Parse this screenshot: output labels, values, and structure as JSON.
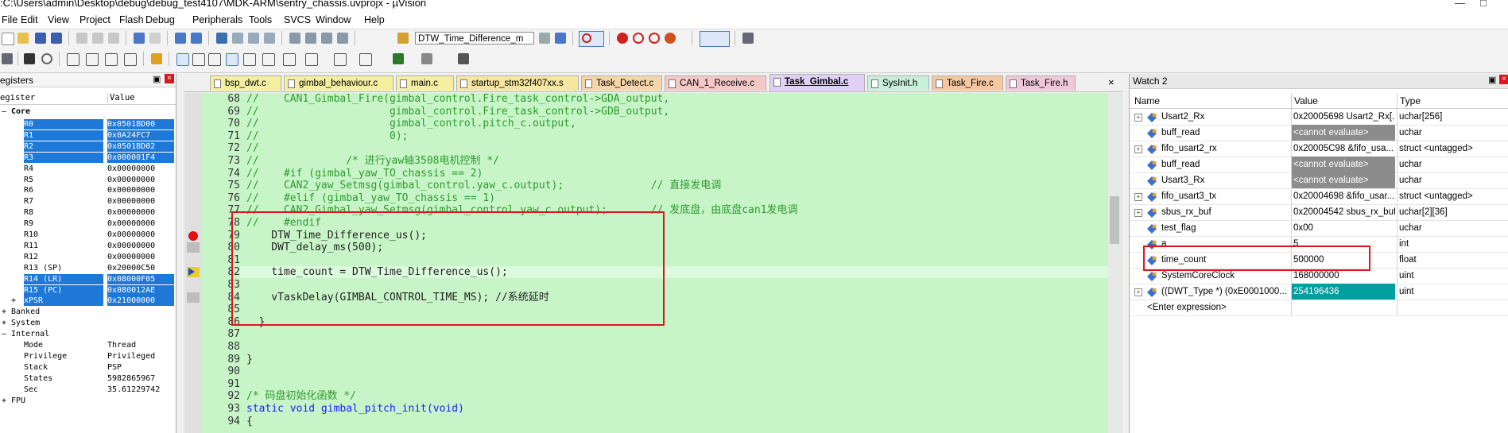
{
  "window": {
    "title": ":C:\\Users\\admin\\Desktop\\debug\\debug_test4107\\MDK-ARM\\sentry_chassis.uvprojx - µVision"
  },
  "menu": [
    "File",
    "Edit",
    "View",
    "Project",
    "Flash",
    "Debug",
    "Peripherals",
    "Tools",
    "SVCS",
    "Window",
    "Help"
  ],
  "toolbar": {
    "target_combo": "DTW_Time_Difference_m"
  },
  "registers": {
    "title": "egisters",
    "col_register": "egister",
    "col_value": "Value",
    "core_label": "Core",
    "rows": [
      {
        "name": "R0",
        "value": "0x0501BD00",
        "sel": true
      },
      {
        "name": "R1",
        "value": "0x0A24FC7",
        "sel": true
      },
      {
        "name": "R2",
        "value": "0x0501BD02",
        "sel": true
      },
      {
        "name": "R3",
        "value": "0x000001F4",
        "sel": true
      },
      {
        "name": "R4",
        "value": "0x00000000",
        "sel": false
      },
      {
        "name": "R5",
        "value": "0x00000000",
        "sel": false
      },
      {
        "name": "R6",
        "value": "0x00000000",
        "sel": false
      },
      {
        "name": "R7",
        "value": "0x00000000",
        "sel": false
      },
      {
        "name": "R8",
        "value": "0x00000000",
        "sel": false
      },
      {
        "name": "R9",
        "value": "0x00000000",
        "sel": false
      },
      {
        "name": "R10",
        "value": "0x00000000",
        "sel": false
      },
      {
        "name": "R11",
        "value": "0x00000000",
        "sel": false
      },
      {
        "name": "R12",
        "value": "0x00000000",
        "sel": false
      },
      {
        "name": "R13 (SP)",
        "value": "0x20000C50",
        "sel": false
      },
      {
        "name": "R14 (LR)",
        "value": "0x08000F05",
        "sel": true
      },
      {
        "name": "R15 (PC)",
        "value": "0x080012AE",
        "sel": true
      },
      {
        "name": "xPSR",
        "value": "0x21000000",
        "sel": true
      }
    ],
    "groups": [
      "Banked",
      "System",
      "Internal"
    ],
    "internal": [
      {
        "name": "Mode",
        "value": "Thread"
      },
      {
        "name": "Privilege",
        "value": "Privileged"
      },
      {
        "name": "Stack",
        "value": "PSP"
      },
      {
        "name": "States",
        "value": "5982865967"
      },
      {
        "name": "Sec",
        "value": "35.61229742"
      }
    ],
    "fpu": "FPU"
  },
  "tabs": [
    "bsp_dwt.c",
    "gimbal_behaviour.c",
    "main.c",
    "startup_stm32f407xx.s",
    "Task_Detect.c",
    "CAN_1_Receive.c",
    "Task_Gimbal.c",
    "SysInit.h",
    "Task_Fire.c",
    "Task_Fire.h"
  ],
  "tab_colors": [
    "#f5f0a0",
    "#f5f0a0",
    "#f5f0a0",
    "#f5e6a0",
    "#f5d6a8",
    "#f5c8c8",
    "#e0d0f5",
    "#c8f0d8",
    "#f5c8a0",
    "#f0c8d8"
  ],
  "active_tab": "Task_Gimbal.c",
  "code": {
    "line_numbers": [
      "68",
      "69",
      "70",
      "71",
      "72",
      "73",
      "74",
      "75",
      "76",
      "77",
      "78",
      "79",
      "80",
      "81",
      "82",
      "83",
      "84",
      "85",
      "86",
      "87",
      "88",
      "89",
      "90",
      "91",
      "92",
      "93",
      "94"
    ],
    "lines": [
      "//    CAN1_Gimbal_Fire(gimbal_control.Fire_task_control->GDA_output,",
      "//                     gimbal_control.Fire_task_control->GDB_output,",
      "//                     gimbal_control.pitch_c.output,",
      "//                     0);",
      "//",
      "//              /* 进行yaw轴3508电机控制 */",
      "//    #if (gimbal_yaw_TO_chassis == 2)",
      "//    CAN2_yaw_Setmsg(gimbal_control.yaw_c.output);              // 直接发电调",
      "//    #elif (gimbal_yaw_TO_chassis == 1)",
      "//    CAN2_Gimbal_yaw_Setmsg(gimbal_control.yaw_c.output);       // 发底盘，由底盘can1发电调",
      "//    #endif",
      "    DTW_Time_Difference_us();",
      "    DWT_delay_ms(500);",
      "",
      "    time_count = DTW_Time_Difference_us();",
      "",
      "    vTaskDelay(GIMBAL_CONTROL_TIME_MS); //系统延时",
      "",
      "  }",
      "",
      "",
      "}",
      "",
      "",
      "/* 码盘初始化函数 */",
      "static void gimbal_pitch_init(void)",
      "{"
    ]
  },
  "watch": {
    "title": "Watch 2",
    "col_name": "Name",
    "col_value": "Value",
    "col_type": "Type",
    "rows": [
      {
        "name": "Usart2_Rx",
        "value": "0x20005698 Usart2_Rx[...",
        "type": "uchar[256]",
        "expand": true,
        "style": ""
      },
      {
        "name": "buff_read",
        "value": "<cannot evaluate>",
        "type": "uchar",
        "expand": false,
        "style": "gray"
      },
      {
        "name": "fifo_usart2_rx",
        "value": "0x20005C98 &fifo_usa...",
        "type": "struct <untagged>",
        "expand": true,
        "style": ""
      },
      {
        "name": "buff_read",
        "value": "<cannot evaluate>",
        "type": "uchar",
        "expand": false,
        "style": "gray"
      },
      {
        "name": "Usart3_Rx",
        "value": "<cannot evaluate>",
        "type": "uchar",
        "expand": false,
        "style": "gray"
      },
      {
        "name": "fifo_usart3_tx",
        "value": "0x20004698 &fifo_usar...",
        "type": "struct <untagged>",
        "expand": true,
        "style": ""
      },
      {
        "name": "sbus_rx_buf",
        "value": "0x20004542 sbus_rx_buf",
        "type": "uchar[2][36]",
        "expand": true,
        "style": ""
      },
      {
        "name": "test_flag",
        "value": "0x00",
        "type": "uchar",
        "expand": false,
        "style": ""
      },
      {
        "name": "a",
        "value": "5",
        "type": "int",
        "expand": false,
        "style": ""
      },
      {
        "name": "time_count",
        "value": "500000",
        "type": "float",
        "expand": false,
        "style": ""
      },
      {
        "name": "SystemCoreClock",
        "value": "168000000",
        "type": "uint",
        "expand": false,
        "style": ""
      },
      {
        "name": "((DWT_Type *) (0xE0001000...",
        "value": "254196436",
        "type": "uint",
        "expand": true,
        "style": "teal"
      }
    ],
    "enter_expression": "<Enter expression>"
  }
}
